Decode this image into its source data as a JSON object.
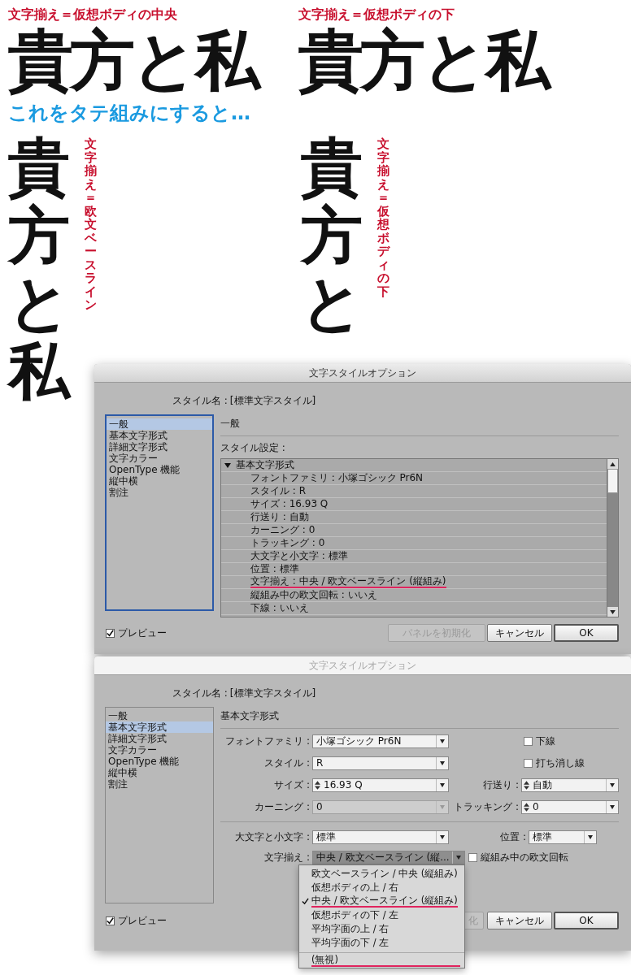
{
  "samples_horizontal": [
    {
      "caption": "文字揃え＝仮想ボディの中央",
      "text": "貴方と私"
    },
    {
      "caption": "文字揃え＝仮想ボディの下",
      "text": "貴方と私"
    }
  ],
  "heading": "これをタテ組みにすると…",
  "samples_vertical": [
    {
      "caption": "文字揃え＝欧文ベースライン",
      "text": "貴方と私"
    },
    {
      "caption": "文字揃え＝仮想ボディの下",
      "text": "貴方と"
    }
  ],
  "dialog_general": {
    "title": "文字スタイルオプション",
    "active": true,
    "style_name_label": "スタイル名 :",
    "style_name": "[標準文字スタイル]",
    "categories": [
      {
        "label": "一般",
        "selected": true
      },
      {
        "label": "基本文字形式",
        "selected": false
      },
      {
        "label": "詳細文字形式",
        "selected": false
      },
      {
        "label": "文字カラー",
        "selected": false
      },
      {
        "label": "OpenType 機能",
        "selected": false
      },
      {
        "label": "縦中横",
        "selected": false
      },
      {
        "label": "割注",
        "selected": false
      }
    ],
    "section_title": "一般",
    "settings_label": "スタイル設定 :",
    "tree": {
      "label": "基本文字形式",
      "expanded": true,
      "children": [
        {
          "label": "フォントファミリ : 小塚ゴシック Pr6N",
          "underlined": false
        },
        {
          "label": "スタイル : R",
          "underlined": false
        },
        {
          "label": "サイズ : 16.93 Q",
          "underlined": false
        },
        {
          "label": "行送り : 自動",
          "underlined": false
        },
        {
          "label": "カーニング : 0",
          "underlined": false
        },
        {
          "label": "トラッキング : 0",
          "underlined": false
        },
        {
          "label": "大文字と小文字 : 標準",
          "underlined": false
        },
        {
          "label": "位置 : 標準",
          "underlined": false
        },
        {
          "label": "文字揃え : 中央 / 欧文ベースライン (縦組み)",
          "underlined": true
        },
        {
          "label": "縦組み中の欧文回転 : いいえ",
          "underlined": false
        },
        {
          "label": "下線 : いいえ",
          "underlined": false
        }
      ]
    },
    "preview": {
      "label": "プレビュー",
      "checked": true
    },
    "buttons": [
      {
        "label": "パネルを初期化",
        "disabled": true,
        "default": false
      },
      {
        "label": "キャンセル",
        "disabled": false,
        "default": false
      },
      {
        "label": "OK",
        "disabled": false,
        "default": true
      }
    ]
  },
  "dialog_basic": {
    "title": "文字スタイルオプション",
    "active": false,
    "style_name_label": "スタイル名 :",
    "style_name": "[標準文字スタイル]",
    "categories": [
      {
        "label": "一般",
        "selected": false
      },
      {
        "label": "基本文字形式",
        "selected": true
      },
      {
        "label": "詳細文字形式",
        "selected": false
      },
      {
        "label": "文字カラー",
        "selected": false
      },
      {
        "label": "OpenType 機能",
        "selected": false
      },
      {
        "label": "縦中横",
        "selected": false
      },
      {
        "label": "割注",
        "selected": false
      }
    ],
    "section_title": "基本文字形式",
    "rows_top": [
      {
        "left": {
          "label": "フォントファミリ :",
          "kind": "select",
          "value": "小塚ゴシック Pr6N",
          "disabled": false
        },
        "right": {
          "kind": "checkbox",
          "label": "下線",
          "checked": false
        }
      },
      {
        "left": {
          "label": "スタイル :",
          "kind": "select",
          "value": "R",
          "disabled": false
        },
        "right": {
          "kind": "checkbox",
          "label": "打ち消し線",
          "checked": false
        }
      },
      {
        "left": {
          "label": "サイズ :",
          "kind": "spin",
          "value": "16.93 Q",
          "disabled": false
        },
        "right": {
          "kind": "spin",
          "label": "行送り :",
          "value": "自動"
        }
      },
      {
        "left": {
          "label": "カーニング :",
          "kind": "select",
          "value": "0",
          "disabled": true
        },
        "right": {
          "kind": "spin",
          "label": "トラッキング :",
          "value": "0"
        }
      }
    ],
    "case": {
      "label": "大文字と小文字 :",
      "value": "標準"
    },
    "position": {
      "label": "位置 :",
      "value": "標準"
    },
    "alignment": {
      "label": "文字揃え :",
      "value": "中央 / 欧文ベースライン (縦...",
      "open": true
    },
    "rotate": {
      "label": "縦組み中の欧文回転",
      "checked": false
    },
    "menu": {
      "items": [
        {
          "label": "欧文ベースライン / 中央 (縦組み)",
          "checked": false,
          "underlined": false
        },
        {
          "label": "仮想ボディの上 / 右",
          "checked": false,
          "underlined": false
        },
        {
          "label": "中央 / 欧文ベースライン (縦組み)",
          "checked": true,
          "underlined": true
        },
        {
          "label": "仮想ボディの下 / 左",
          "checked": false,
          "underlined": false
        },
        {
          "label": "平均字面の上 / 右",
          "checked": false,
          "underlined": false
        },
        {
          "label": "平均字面の下 / 左",
          "checked": false,
          "underlined": false
        }
      ],
      "after_separator": [
        {
          "label": "(無視)",
          "checked": false,
          "underlined": true
        }
      ]
    },
    "preview": {
      "label": "プレビュー",
      "checked": true
    },
    "buttons": [
      {
        "label": "化",
        "disabled": true,
        "default": false
      },
      {
        "label": "キャンセル",
        "disabled": false,
        "default": false
      },
      {
        "label": "OK",
        "disabled": false,
        "default": true
      }
    ]
  }
}
